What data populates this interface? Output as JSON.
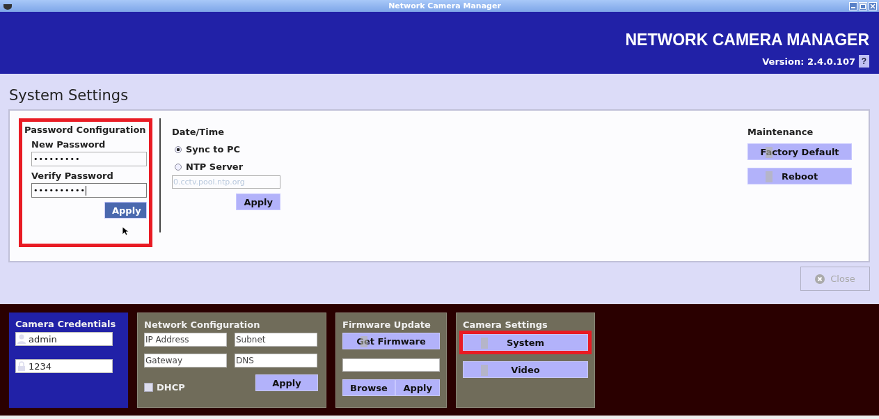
{
  "window": {
    "title": "Network Camera Manager"
  },
  "header": {
    "title": "NETWORK CAMERA MANAGER",
    "version": "Version: 2.4.0.107",
    "help": "?"
  },
  "page_title": "System Settings",
  "password": {
    "title": "Password Configuration",
    "highlighted": true,
    "fields": [
      {
        "label": "New Password",
        "value": "•••••••••",
        "focused": false
      },
      {
        "label": "Verify Password",
        "value": "••••••••••",
        "focused": true
      }
    ],
    "apply": "Apply"
  },
  "datetime": {
    "title": "Date/Time",
    "options": [
      {
        "label": "Sync to PC",
        "selected": true
      },
      {
        "label": "NTP Server",
        "selected": false
      }
    ],
    "server": {
      "value": "0.cctv.pool.ntp.org",
      "disabled": true
    },
    "apply": "Apply"
  },
  "maintenance": {
    "title": "Maintenance",
    "buttons": [
      "Factory Default",
      "Reboot"
    ]
  },
  "close": {
    "label": "Close",
    "disabled": true
  },
  "credentials": {
    "title": "Camera Credentials",
    "username": "admin",
    "password": "1234"
  },
  "network": {
    "title": "Network Configuration",
    "fields": [
      {
        "placeholder": "IP Address"
      },
      {
        "placeholder": "Subnet"
      },
      {
        "placeholder": "Gateway"
      },
      {
        "placeholder": "DNS"
      }
    ],
    "dhcp": {
      "label": "DHCP",
      "checked": false
    },
    "apply": "Apply"
  },
  "firmware": {
    "title": "Firmware Update",
    "get": "Get Firmware",
    "browse": "Browse",
    "apply": "Apply"
  },
  "camera_settings": {
    "title": "Camera Settings",
    "buttons": [
      {
        "label": "System",
        "highlighted": true
      },
      {
        "label": "Video",
        "highlighted": false
      }
    ]
  }
}
